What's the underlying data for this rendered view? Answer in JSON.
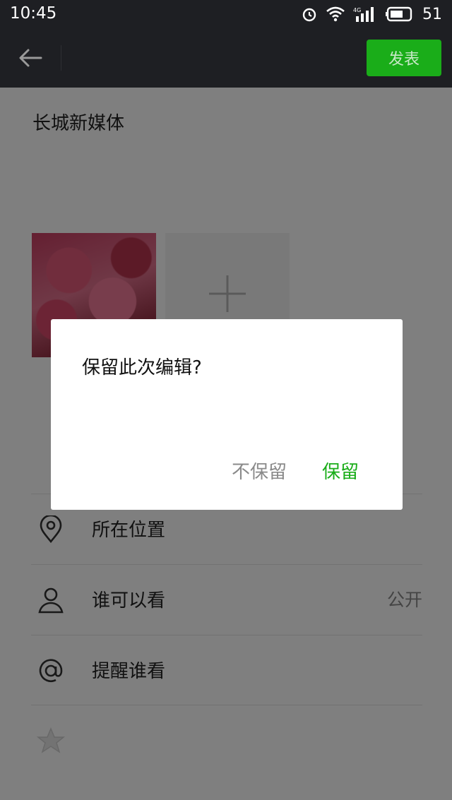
{
  "status_bar": {
    "time": "10:45",
    "battery": "51",
    "icons": [
      "alarm-icon",
      "wifi-icon",
      "signal-4g-icon",
      "battery-icon"
    ]
  },
  "nav": {
    "back_icon": "arrow-left-icon",
    "publish_label": "发表"
  },
  "post": {
    "text": "长城新媒体",
    "photos": [
      {
        "description_icon": "pink-blossom-photo"
      }
    ],
    "add_icon": "plus-icon"
  },
  "options": [
    {
      "icon": "location-pin-icon",
      "label": "所在位置",
      "value": ""
    },
    {
      "icon": "person-icon",
      "label": "谁可以看",
      "value": "公开"
    },
    {
      "icon": "at-icon",
      "label": "提醒谁看",
      "value": ""
    },
    {
      "icon": "star-icon",
      "label": "",
      "value": ""
    }
  ],
  "dialog": {
    "title": "保留此次编辑?",
    "discard_label": "不保留",
    "keep_label": "保留"
  },
  "colors": {
    "accent": "#1aad19",
    "header_bg": "#1e1f23"
  }
}
